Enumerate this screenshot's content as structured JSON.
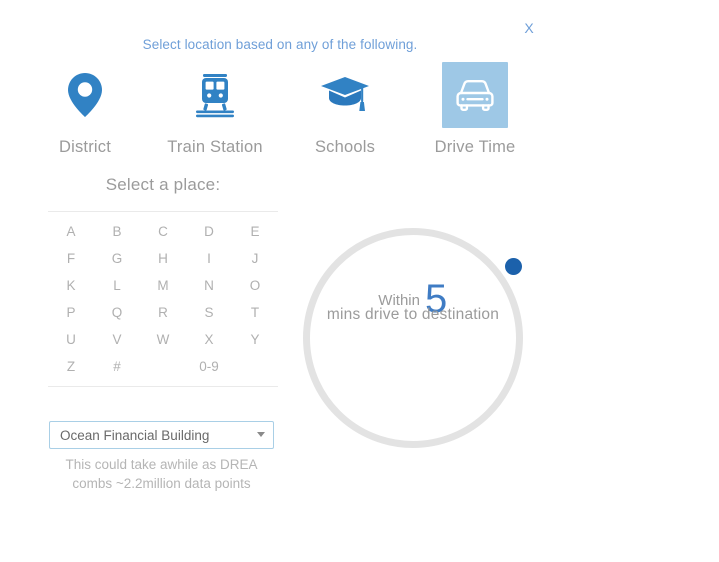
{
  "dialog": {
    "close_label": "X",
    "headline": "Select location based on any of the following."
  },
  "categories": [
    {
      "label": "District",
      "icon": "map-pin-icon",
      "selected": false
    },
    {
      "label": "Train Station",
      "icon": "train-icon",
      "selected": false
    },
    {
      "label": "Schools",
      "icon": "graduation-cap-icon",
      "selected": false
    },
    {
      "label": "Drive Time",
      "icon": "car-icon",
      "selected": true
    }
  ],
  "place_picker": {
    "title": "Select a place:",
    "alpha_rows": [
      [
        "A",
        "B",
        "C",
        "D",
        "E"
      ],
      [
        "F",
        "G",
        "H",
        "I",
        "J"
      ],
      [
        "K",
        "L",
        "M",
        "N",
        "O"
      ],
      [
        "P",
        "Q",
        "R",
        "S",
        "T"
      ],
      [
        "U",
        "V",
        "W",
        "X",
        "Y"
      ],
      [
        "Z",
        "#",
        "",
        "0-9",
        ""
      ]
    ],
    "selected_place": "Ocean Financial Building",
    "options": [
      "Ocean Financial Building"
    ],
    "hint": "This could take awhile as DREA combs ~2.2million data points"
  },
  "drive_time_dial": {
    "prefix": "Within",
    "value": "5",
    "suffix": "mins drive to destination"
  },
  "colors": {
    "accent_blue": "#3182c4",
    "tile_blue": "#9ec8e6",
    "handle_blue": "#1c61ab",
    "headline_blue": "#6f9fd8",
    "label_gray": "#9b9b9b",
    "ring_gray": "#e3e3e3"
  }
}
